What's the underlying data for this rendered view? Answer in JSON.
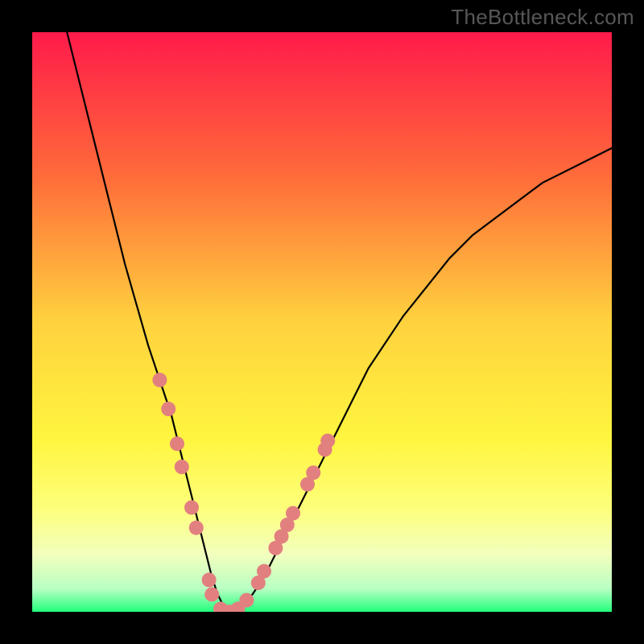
{
  "watermark": "TheBottleneck.com",
  "chart_data": {
    "type": "line",
    "title": "",
    "xlabel": "",
    "ylabel": "",
    "xlim": [
      0,
      100
    ],
    "ylim": [
      0,
      100
    ],
    "background_gradient": {
      "stops": [
        {
          "offset": 0.0,
          "color": "#ff1a4a"
        },
        {
          "offset": 0.25,
          "color": "#ff6c3a"
        },
        {
          "offset": 0.5,
          "color": "#ffd23e"
        },
        {
          "offset": 0.7,
          "color": "#fff53f"
        },
        {
          "offset": 0.82,
          "color": "#fdff7a"
        },
        {
          "offset": 0.9,
          "color": "#f3ffbd"
        },
        {
          "offset": 0.96,
          "color": "#b9ffc3"
        },
        {
          "offset": 1.0,
          "color": "#23ff7b"
        }
      ]
    },
    "series": [
      {
        "name": "bottleneck-curve",
        "color": "#000000",
        "width": 2.2,
        "x": [
          6,
          8,
          10,
          12,
          14,
          16,
          18,
          20,
          22,
          24,
          25,
          26,
          27,
          28,
          29,
          30,
          31,
          32,
          33,
          34,
          35,
          36,
          38,
          40,
          42,
          44,
          46,
          48,
          50,
          52,
          54,
          56,
          58,
          60,
          64,
          68,
          72,
          76,
          80,
          84,
          88,
          92,
          96,
          100
        ],
        "y": [
          100,
          92,
          84,
          76,
          68,
          60,
          53,
          46,
          40,
          34,
          30,
          26,
          22,
          18,
          14,
          10,
          6,
          3,
          1,
          0,
          0,
          1,
          3,
          6,
          10,
          14,
          18,
          22,
          26,
          30,
          34,
          38,
          42,
          45,
          51,
          56,
          61,
          65,
          68,
          71,
          74,
          76,
          78,
          80
        ]
      }
    ],
    "markers": {
      "name": "benchmark-points",
      "color": "#e28080",
      "radius": 9,
      "points": [
        {
          "x": 22.0,
          "y": 40.0
        },
        {
          "x": 23.5,
          "y": 35.0
        },
        {
          "x": 25.0,
          "y": 29.0
        },
        {
          "x": 25.8,
          "y": 25.0
        },
        {
          "x": 27.5,
          "y": 18.0
        },
        {
          "x": 28.3,
          "y": 14.5
        },
        {
          "x": 30.5,
          "y": 5.5
        },
        {
          "x": 31.0,
          "y": 3.0
        },
        {
          "x": 32.5,
          "y": 0.5
        },
        {
          "x": 34.0,
          "y": 0.0
        },
        {
          "x": 35.5,
          "y": 0.5
        },
        {
          "x": 37.0,
          "y": 2.0
        },
        {
          "x": 39.0,
          "y": 5.0
        },
        {
          "x": 40.0,
          "y": 7.0
        },
        {
          "x": 42.0,
          "y": 11.0
        },
        {
          "x": 43.0,
          "y": 13.0
        },
        {
          "x": 44.0,
          "y": 15.0
        },
        {
          "x": 45.0,
          "y": 17.0
        },
        {
          "x": 47.5,
          "y": 22.0
        },
        {
          "x": 48.5,
          "y": 24.0
        },
        {
          "x": 50.5,
          "y": 28.0
        },
        {
          "x": 51.0,
          "y": 29.5
        }
      ]
    }
  }
}
